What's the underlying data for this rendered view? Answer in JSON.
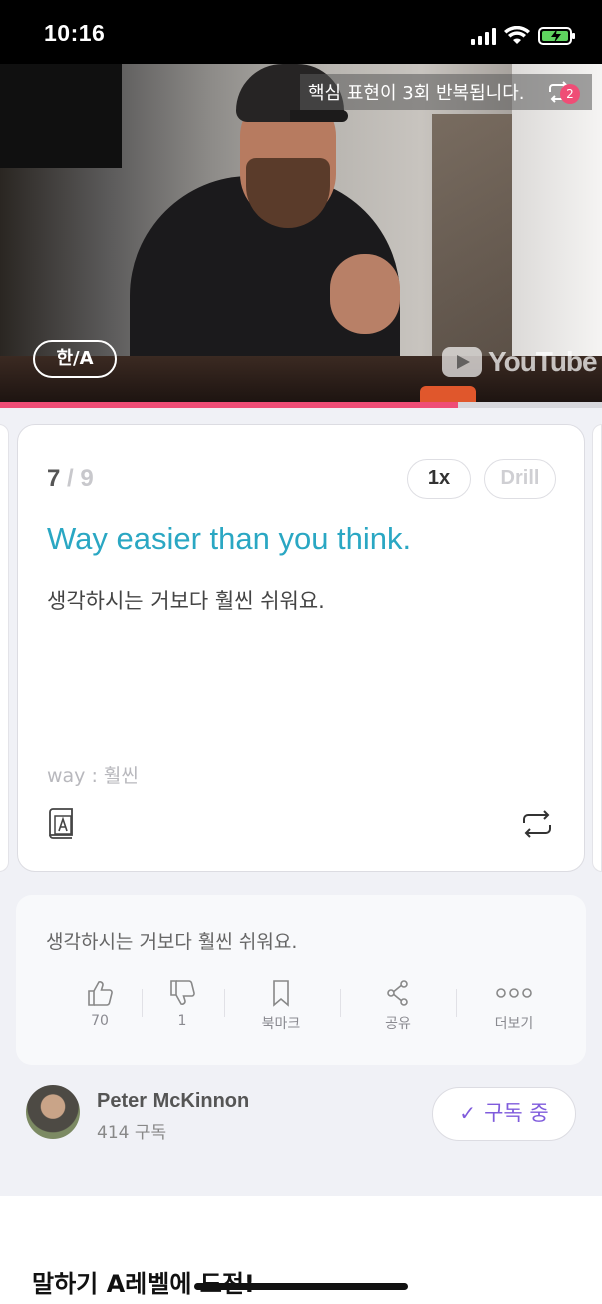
{
  "status_bar": {
    "time": "10:16"
  },
  "video": {
    "repeat_banner_text": "핵심 표현이 3회 반복됩니다.",
    "repeat_count_badge": "2",
    "lang_toggle_label": "한/A",
    "watermark": "YouTube",
    "progress_fraction": 0.76
  },
  "card": {
    "current_index": "7",
    "separator": " / ",
    "total": "9",
    "speed_label": "1x",
    "drill_label": "Drill",
    "sentence_en": "Way easier than you think.",
    "sentence_ko": "생각하시는 거보다 훨씬 쉬워요.",
    "vocab": "way : 훨씬"
  },
  "info": {
    "translation": "생각하시는 거보다 훨씬 쉬워요.",
    "actions": [
      {
        "icon": "thumbs-up-icon",
        "label": "70"
      },
      {
        "icon": "thumbs-down-icon",
        "label": "1"
      },
      {
        "icon": "bookmark-icon",
        "label": "북마크"
      },
      {
        "icon": "share-icon",
        "label": "공유"
      },
      {
        "icon": "more-icon",
        "label": "더보기"
      }
    ]
  },
  "channel": {
    "name": "Peter McKinnon",
    "subscribers": "414 구독",
    "subscribe_label": "구독 중",
    "accent_color": "#7f5bdc"
  },
  "section": {
    "title": "말하기 A레벨에 도전!"
  },
  "colors": {
    "progress": "#ef4d76",
    "english_sentence": "#2aa7c3",
    "badge": "#ef4d76"
  }
}
